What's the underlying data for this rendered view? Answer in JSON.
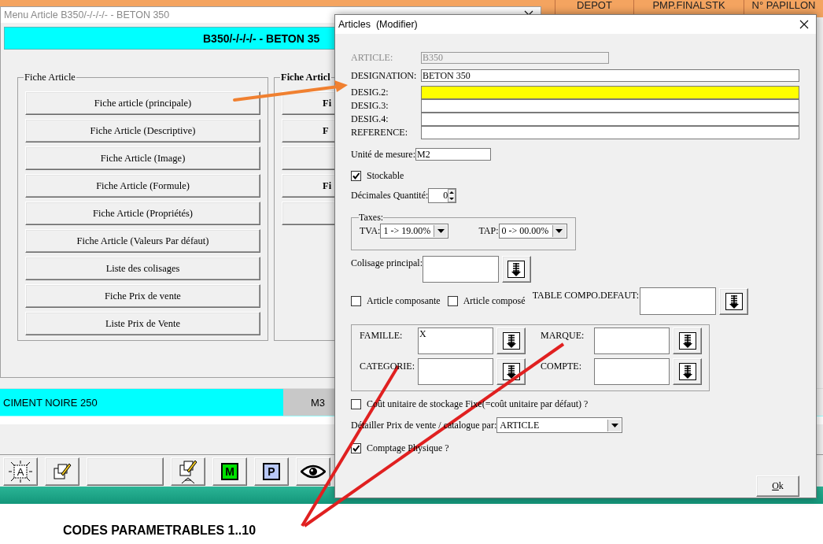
{
  "background": {
    "columns": [
      {
        "label": "DEPOT"
      },
      {
        "label": "PMP.FINALSTK"
      },
      {
        "label": "N° PAPILLON"
      }
    ],
    "rows": [
      {
        "cells": [
          "CIMENT NOIRE 250",
          "M3"
        ],
        "selected": true
      }
    ],
    "toolbar": [
      {
        "kind": "framed-letter",
        "label": "A"
      },
      {
        "kind": "edit"
      },
      {
        "kind": "blank"
      },
      {
        "kind": "edit-stand"
      },
      {
        "kind": "letter",
        "label": "M",
        "color": "#00e000"
      },
      {
        "kind": "letter",
        "label": "P",
        "color": "#b8c8f8"
      },
      {
        "kind": "eye"
      }
    ]
  },
  "menu_window": {
    "title": "Menu Article B350/-/-/-/- - BETON 350",
    "banner": "B350/-/-/-/- - BETON 35",
    "groups": [
      {
        "title": "Fiche Article",
        "buttons": [
          {
            "label": "Fiche article (principale)"
          },
          {
            "label": "Fiche Article (Descriptive)"
          },
          {
            "label": "Fiche Article (Image)"
          },
          {
            "label": "Fiche Article (Formule)"
          },
          {
            "label": "Fiche Article (Propriétés)"
          },
          {
            "label": "Fiche Article (Valeurs Par défaut)"
          },
          {
            "label": "Liste des colisages"
          },
          {
            "label": "Fiche Prix de vente"
          },
          {
            "label": "Liste Prix de Vente"
          }
        ]
      },
      {
        "title": "Fiche Articl",
        "buttons": [
          {
            "kind": "labelled",
            "label": "Fi"
          },
          {
            "kind": "labelled",
            "label": "F"
          },
          {
            "kind": "plain"
          },
          {
            "kind": "labelled",
            "label": "Fi"
          },
          {
            "kind": "plain"
          }
        ]
      }
    ]
  },
  "dialog": {
    "title": "Articles  (Modifier)",
    "fields": [
      {
        "label": "ARTICLE:",
        "value": "B350",
        "disabled": true,
        "highlighted": false
      },
      {
        "label": "DESIGNATION:",
        "value": "BETON 350",
        "disabled": false,
        "highlighted": false
      },
      {
        "label": "DESIG.2:",
        "disabled": false,
        "highlighted": true
      },
      {
        "label": "DESIG.3:",
        "disabled": false,
        "highlighted": false
      },
      {
        "label": "DESIG.4:",
        "disabled": false,
        "highlighted": false
      },
      {
        "label": "REFERENCE:",
        "disabled": false,
        "highlighted": false
      }
    ],
    "unit": {
      "label": "Unité de mesure:",
      "value": "M2"
    },
    "stockable": {
      "label": "Stockable",
      "checked": true
    },
    "decimals": {
      "label": "Décimales Quantité:",
      "value": "0"
    },
    "taxes": {
      "title": "Taxes:",
      "selects": [
        {
          "label": "TVA:",
          "value": "1 -> 19.00%"
        },
        {
          "label": "TAP:",
          "value": "0 -> 00.00%"
        }
      ]
    },
    "colisage": {
      "label": "Colisage principal:"
    },
    "composition": {
      "checkboxes": [
        {
          "label": "Article composante",
          "checked": false
        },
        {
          "label": "Article composé",
          "checked": false
        }
      ],
      "table_label": "TABLE COMPO.DEFAUT:"
    },
    "codes": [
      {
        "label": "FAMILLE:",
        "value": "X"
      },
      {
        "label": "MARQUE:"
      },
      {
        "label": "CATEGORIE:"
      },
      {
        "label": "COMPTE:"
      }
    ],
    "fixed_cost": {
      "label": "Coût unitaire de stockage Fixe(=coût unitaire par défaut) ?",
      "checked": false
    },
    "detail_price": {
      "label": "Détailler Prix de vente / catalogue par:",
      "value": "ARTICLE"
    },
    "physical_count": {
      "label": "Comptage Physique ?",
      "checked": true
    },
    "ok_button": "Ok"
  },
  "annotation": {
    "text": "CODES PARAMETRABLES 1..10"
  }
}
